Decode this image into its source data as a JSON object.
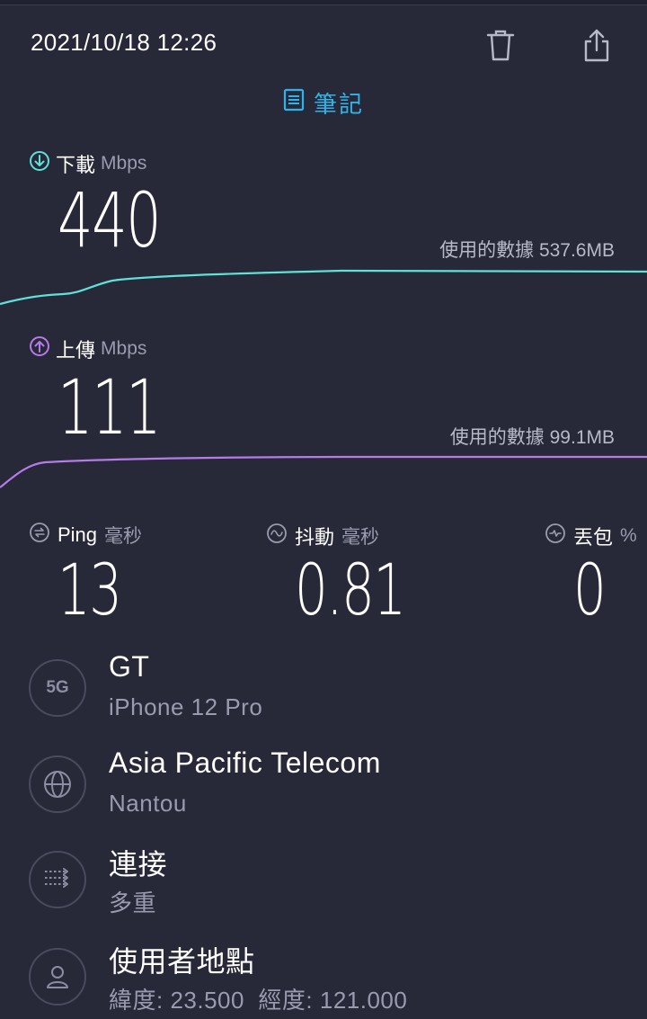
{
  "header": {
    "datetime": "2021/10/18 12:26",
    "notes_label": "筆記",
    "icons": {
      "delete": "trash-icon",
      "share": "share-icon",
      "notes": "notes-icon"
    }
  },
  "download": {
    "label": "下載",
    "unit": "Mbps",
    "value": "440",
    "usage_label": "使用的數據",
    "usage_value": "537.6MB",
    "color": "#5fe0d8"
  },
  "upload": {
    "label": "上傳",
    "unit": "Mbps",
    "value": "111",
    "usage_label": "使用的數據",
    "usage_value": "99.1MB",
    "color": "#b77be8"
  },
  "stats": {
    "ping": {
      "label": "Ping",
      "unit": "毫秒",
      "value": "13"
    },
    "jitter": {
      "label": "抖動",
      "unit": "毫秒",
      "value": "0.81"
    },
    "loss": {
      "label": "丟包",
      "unit": "%",
      "value": "0"
    }
  },
  "info": [
    {
      "icon": "5G",
      "title": "GT",
      "subtitle": "iPhone 12 Pro"
    },
    {
      "icon": "globe-icon",
      "title": "Asia Pacific Telecom",
      "subtitle": "Nantou"
    },
    {
      "icon": "connections-icon",
      "title": "連接",
      "subtitle": "多重"
    },
    {
      "icon": "user-icon",
      "title": "使用者地點",
      "subtitle": "緯度: 23.500  經度: 121.000"
    }
  ]
}
